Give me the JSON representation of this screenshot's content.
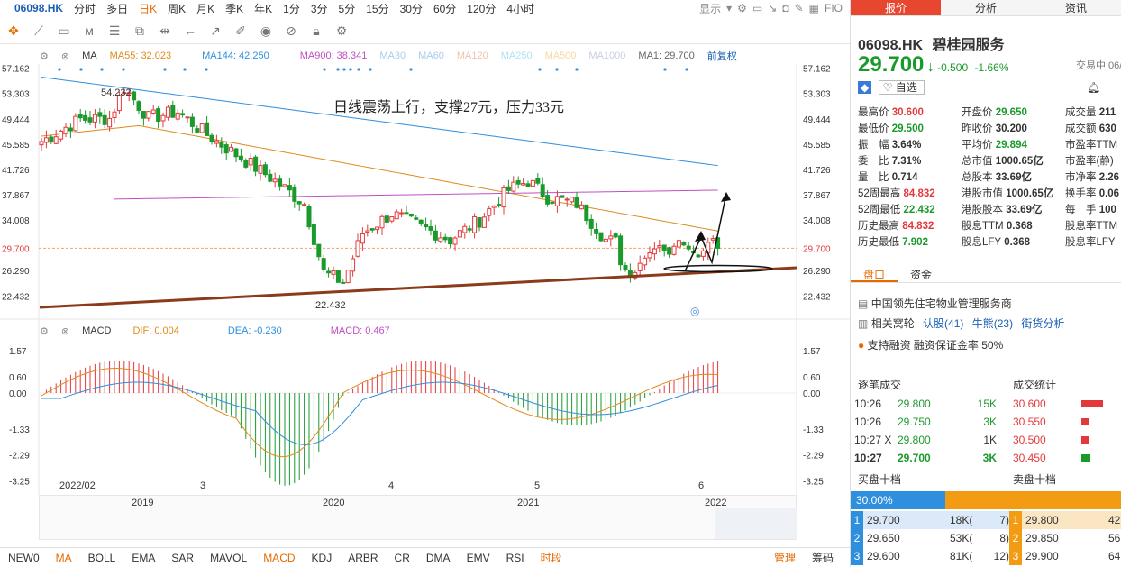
{
  "topbar": {
    "code": "06098.HK",
    "periods": [
      "分时",
      "多日",
      "日K",
      "周K",
      "月K",
      "季K",
      "年K",
      "1分",
      "3分",
      "5分",
      "15分",
      "30分",
      "60分",
      "120分",
      "4小时"
    ],
    "active_period_index": 2,
    "display_label": "显示",
    "fio_label": "FIO"
  },
  "ma_legend": {
    "label": "MA",
    "ma55": "MA55: 32.023",
    "ma144": "MA144: 42.250",
    "ma900": "MA900: 38.341",
    "ma30": "MA30",
    "ma60": "MA60",
    "ma120": "MA120",
    "ma250": "MA250",
    "ma500": "MA500",
    "ma1000": "MA1000",
    "ma1": "MA1: 29.700",
    "adjust": "前复权"
  },
  "annotation": "日线震荡上行，支撑27元，压力33元",
  "price_axis_left": [
    "57.162",
    "53.303",
    "49.444",
    "45.585",
    "41.726",
    "37.867",
    "34.008",
    "29.700",
    "26.290",
    "22.432"
  ],
  "price_axis_right": [
    "57.162",
    "53.303",
    "49.444",
    "45.585",
    "41.726",
    "37.867",
    "34.008",
    "29.700",
    "26.290",
    "22.432"
  ],
  "price_labels": {
    "high": "54.232",
    "low": "22.432"
  },
  "macd_legend": {
    "label": "MACD",
    "dif": "DIF: 0.004",
    "dea": "DEA: -0.230",
    "macd": "MACD: 0.467"
  },
  "macd_axis": [
    "1.57",
    "0.60",
    "0.00",
    "-1.33",
    "-2.29",
    "-3.25"
  ],
  "date_axis": [
    "2022/02",
    "3",
    "4",
    "5",
    "6"
  ],
  "year_axis": [
    "2019",
    "2020",
    "2021",
    "2022"
  ],
  "bottombar": {
    "items": [
      "NEW0",
      "MA",
      "BOLL",
      "EMA",
      "SAR",
      "MAVOL",
      "MACD",
      "KDJ",
      "ARBR",
      "CR",
      "DMA",
      "EMV",
      "RSI",
      "时段"
    ],
    "right": [
      "管理",
      "筹码"
    ]
  },
  "colors": {
    "up": "#e4393c",
    "down": "#1b9a2c",
    "ma55": "#e08a1e",
    "ma144": "#2f8fdf",
    "ma900": "#c24fc2",
    "trend": "#8b3a1a"
  },
  "rightpanel": {
    "tabs": [
      "报价",
      "分析",
      "资讯"
    ],
    "code": "06098.HK",
    "name": "碧桂园服务",
    "price": "29.700",
    "change": "-0.500",
    "change_pct": "-1.66%",
    "status": "交易中 06/",
    "watch_label": "自选",
    "quote_rows": [
      [
        "最高价",
        "30.600",
        "开盘价",
        "29.650",
        "成交量",
        "211"
      ],
      [
        "最低价",
        "29.500",
        "昨收价",
        "30.200",
        "成交额",
        "630"
      ],
      [
        "振　幅",
        "3.64%",
        "平均价",
        "29.894",
        "市盈率TTM",
        ""
      ],
      [
        "委　比",
        "7.31%",
        "总市值",
        "1000.65亿",
        "市盈率(静)",
        ""
      ],
      [
        "量　比",
        "0.714",
        "总股本",
        "33.69亿",
        "市净率",
        "2.26"
      ],
      [
        "52周最高",
        "84.832",
        "港股市值",
        "1000.65亿",
        "换手率",
        "0.06"
      ],
      [
        "52周最低",
        "22.432",
        "港股股本",
        "33.69亿",
        "每　手",
        "100"
      ],
      [
        "历史最高",
        "84.832",
        "股息TTM",
        "0.368",
        "股息率TTM",
        ""
      ],
      [
        "历史最低",
        "7.902",
        "股息LFY",
        "0.368",
        "股息率LFY",
        ""
      ]
    ],
    "sub_tabs": [
      "盘口",
      "资金"
    ],
    "industry": "中国领先住宅物业管理服务商",
    "related_label": "相关窝轮",
    "warrants": "认股(41)",
    "bulls": "牛熊(23)",
    "street": "街货分析",
    "margin": "支持融资  融资保证金率 50%",
    "tick_title": "逐笔成交",
    "stats_title": "成交统计",
    "ticks": [
      [
        "10:26",
        "29.800",
        "15K"
      ],
      [
        "10:26",
        "29.750",
        "3K"
      ],
      [
        "10:27 X",
        "29.800",
        "1K"
      ],
      [
        "10:27",
        "29.700",
        "3K"
      ]
    ],
    "stats": [
      "30.600",
      "30.550",
      "30.500",
      "30.450"
    ],
    "bid_title": "买盘十档",
    "ask_title": "卖盘十档",
    "bid_pct": "30.00%",
    "bids": [
      [
        "1",
        "29.700",
        "18K(",
        "7)"
      ],
      [
        "2",
        "29.650",
        "53K(",
        "8)"
      ],
      [
        "3",
        "29.600",
        "81K(",
        "12)"
      ]
    ],
    "asks": [
      [
        "1",
        "29.800",
        "42"
      ],
      [
        "2",
        "29.850",
        "56"
      ],
      [
        "3",
        "29.900",
        "64"
      ]
    ]
  }
}
